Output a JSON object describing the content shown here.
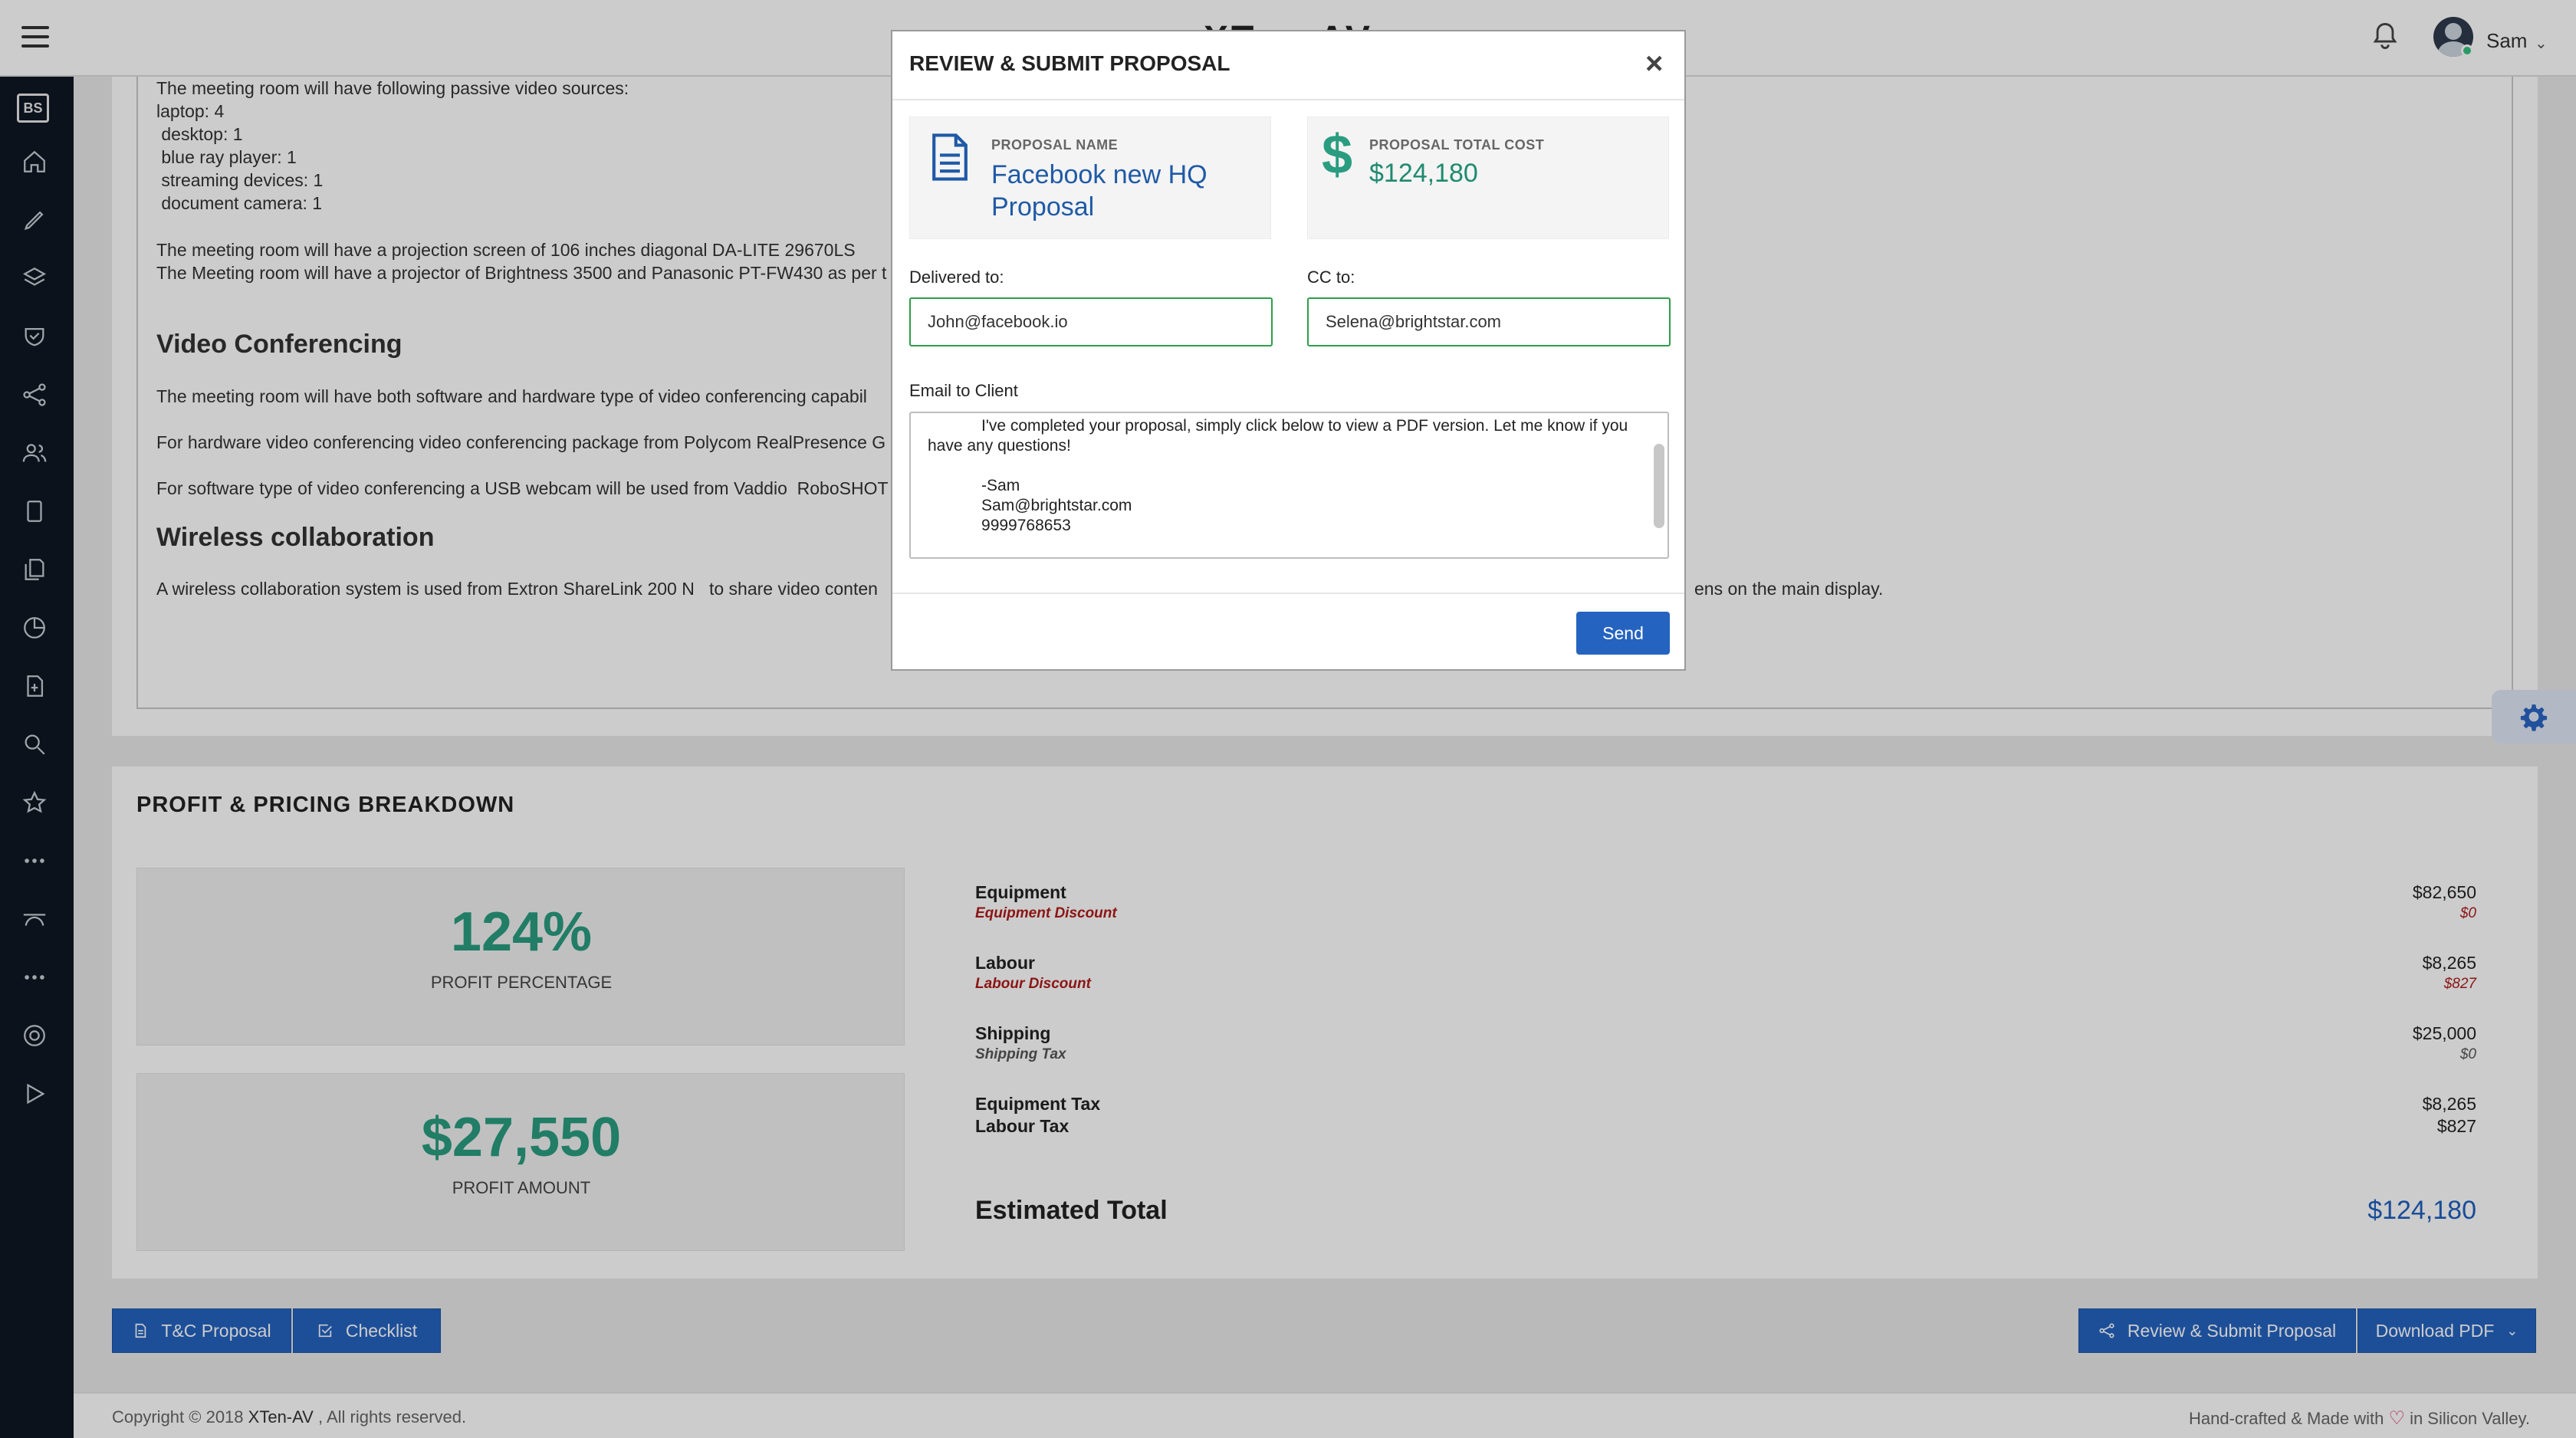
{
  "header": {
    "brand": "XTen-AV",
    "username": "Sam"
  },
  "sidebar": {
    "logo": "BS",
    "items": [
      "home-icon",
      "pencil-icon",
      "layers-icon",
      "shield-icon",
      "share-icon",
      "users-icon",
      "tablet-icon",
      "documents-icon",
      "chart-clock-icon",
      "file-plus-icon",
      "search-icon",
      "star-icon",
      "more-icon",
      "bezier-icon",
      "more-icon",
      "support-icon",
      "play-icon"
    ]
  },
  "document": {
    "lines_top": [
      "The meeting room will have following passive video sources:",
      "laptop: 4",
      " desktop: 1",
      " blue ray player: 1",
      " streaming devices: 1",
      " document camera: 1"
    ],
    "projection_lines": [
      "The meeting room will have a projection screen of 106 inches diagonal DA-LITE 29670LS",
      "The Meeting room will have a projector of Brightness 3500 and Panasonic PT-FW430 as per t"
    ],
    "heading_video": "Video Conferencing",
    "video_lines": [
      "The meeting room will have both software and hardware type of video conferencing capabil",
      "For hardware video conferencing video conferencing package from Polycom RealPresence G",
      "For software type of video conferencing a USB webcam will be used from Vaddio  RoboSHOT"
    ],
    "heading_wireless": "Wireless collaboration",
    "wireless_left": "A wireless collaboration system is used from Extron ShareLink 200 N   to share video conten",
    "wireless_right": "ens on the main display."
  },
  "profit": {
    "title": "PROFIT & PRICING BREAKDOWN",
    "percentage_value": "124%",
    "percentage_label": "PROFIT PERCENTAGE",
    "amount_value": "$27,550",
    "amount_label": "PROFIT AMOUNT",
    "rows": [
      {
        "label": "Equipment",
        "value": "$82,650",
        "sub": "Equipment Discount",
        "subvalue": "$0"
      },
      {
        "label": "Labour",
        "value": "$8,265",
        "sub": "Labour Discount",
        "subvalue": "$827"
      },
      {
        "label": "Shipping",
        "value": "$25,000",
        "sub": "Shipping Tax",
        "subvalue": "$0"
      }
    ],
    "equipment_tax_label": "Equipment Tax",
    "equipment_tax_value": "$8,265",
    "labour_tax_label": "Labour Tax",
    "labour_tax_value": "$827",
    "estimated_label": "Estimated Total",
    "estimated_value": "$124,180"
  },
  "buttons": {
    "tc_proposal": "T&C Proposal",
    "checklist": "Checklist",
    "review_submit": "Review & Submit Proposal",
    "download_pdf": "Download PDF"
  },
  "footer": {
    "copyright_prefix": "Copyright © 2018 ",
    "company": "XTen-AV",
    "copyright_suffix": " , All rights reserved.",
    "crafted_prefix": "Hand-crafted & Made with ",
    "crafted_suffix": " in Silicon Valley."
  },
  "modal": {
    "title": "REVIEW & SUBMIT PROPOSAL",
    "proposal_name_caption": "PROPOSAL NAME",
    "proposal_name": "Facebook new HQ Proposal",
    "total_cost_caption": "PROPOSAL TOTAL COST",
    "total_cost": "$124,180",
    "delivered_label": "Delivered to:",
    "delivered_value": "John@facebook.io",
    "cc_label": "CC to:",
    "cc_value": "Selena@brightstar.com",
    "email_label": "Email to Client",
    "email_body": "            I've completed your proposal, simply click below to view a PDF version. Let me know if you have any questions!\n\n            -Sam\n            Sam@brightstar.com\n            9999768653",
    "send_label": "Send"
  },
  "colors": {
    "accent": "#2563c0",
    "profit_green": "#2a9d80",
    "sidebar_bg": "#0f1723",
    "discount_red": "#b01b1b"
  }
}
